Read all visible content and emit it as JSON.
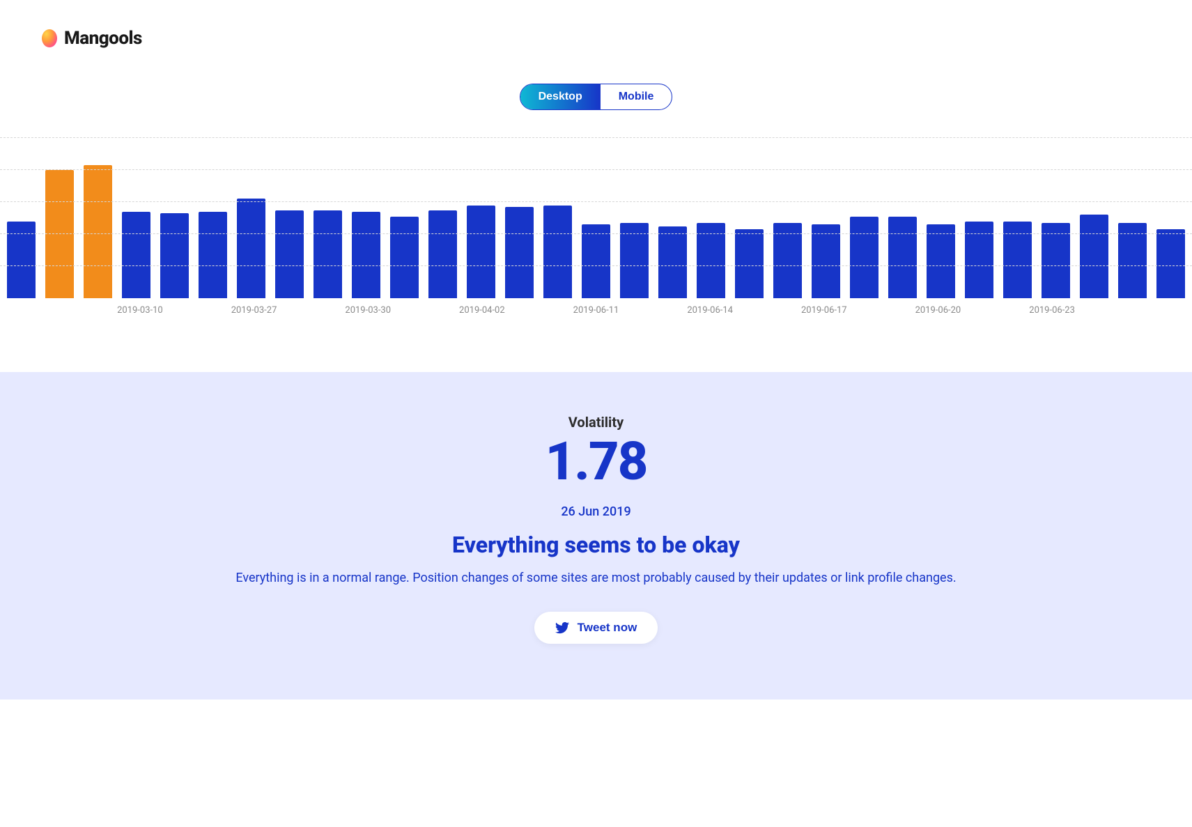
{
  "brand": {
    "name": "Mangools"
  },
  "tabs": {
    "desktop": "Desktop",
    "mobile": "Mobile",
    "active": "desktop"
  },
  "chart_data": {
    "type": "bar",
    "ylim": [
      0,
      5
    ],
    "gridlines": [
      1,
      2,
      3,
      4,
      5
    ],
    "colors": {
      "normal": "#1735c8",
      "highlight": "#f28c1b"
    },
    "series": [
      {
        "value": 2.4,
        "highlight": false
      },
      {
        "value": 4.0,
        "highlight": true
      },
      {
        "value": 4.15,
        "highlight": true
      },
      {
        "value": 2.7,
        "highlight": false
      },
      {
        "value": 2.65,
        "highlight": false
      },
      {
        "value": 2.7,
        "highlight": false
      },
      {
        "value": 3.1,
        "highlight": false
      },
      {
        "value": 2.75,
        "highlight": false
      },
      {
        "value": 2.75,
        "highlight": false
      },
      {
        "value": 2.7,
        "highlight": false
      },
      {
        "value": 2.55,
        "highlight": false
      },
      {
        "value": 2.75,
        "highlight": false
      },
      {
        "value": 2.9,
        "highlight": false
      },
      {
        "value": 2.85,
        "highlight": false
      },
      {
        "value": 2.9,
        "highlight": false
      },
      {
        "value": 2.3,
        "highlight": false
      },
      {
        "value": 2.35,
        "highlight": false
      },
      {
        "value": 2.25,
        "highlight": false
      },
      {
        "value": 2.35,
        "highlight": false
      },
      {
        "value": 2.15,
        "highlight": false
      },
      {
        "value": 2.35,
        "highlight": false
      },
      {
        "value": 2.3,
        "highlight": false
      },
      {
        "value": 2.55,
        "highlight": false
      },
      {
        "value": 2.55,
        "highlight": false
      },
      {
        "value": 2.3,
        "highlight": false
      },
      {
        "value": 2.4,
        "highlight": false
      },
      {
        "value": 2.4,
        "highlight": false
      },
      {
        "value": 2.35,
        "highlight": false
      },
      {
        "value": 2.6,
        "highlight": false
      },
      {
        "value": 2.35,
        "highlight": false
      },
      {
        "value": 2.15,
        "highlight": false
      }
    ],
    "x_ticks": [
      {
        "index": 3,
        "label": "2019-03-10"
      },
      {
        "index": 6,
        "label": "2019-03-27"
      },
      {
        "index": 9,
        "label": "2019-03-30"
      },
      {
        "index": 12,
        "label": "2019-04-02"
      },
      {
        "index": 15,
        "label": "2019-06-11"
      },
      {
        "index": 18,
        "label": "2019-06-14"
      },
      {
        "index": 21,
        "label": "2019-06-17"
      },
      {
        "index": 24,
        "label": "2019-06-20"
      },
      {
        "index": 27,
        "label": "2019-06-23"
      }
    ]
  },
  "info": {
    "label": "Volatility",
    "value": "1.78",
    "date": "26 Jun 2019",
    "headline": "Everything seems to be okay",
    "description": "Everything is in a normal range. Position changes of some sites are most probably caused by their updates or link profile changes.",
    "tweet_label": "Tweet now"
  }
}
